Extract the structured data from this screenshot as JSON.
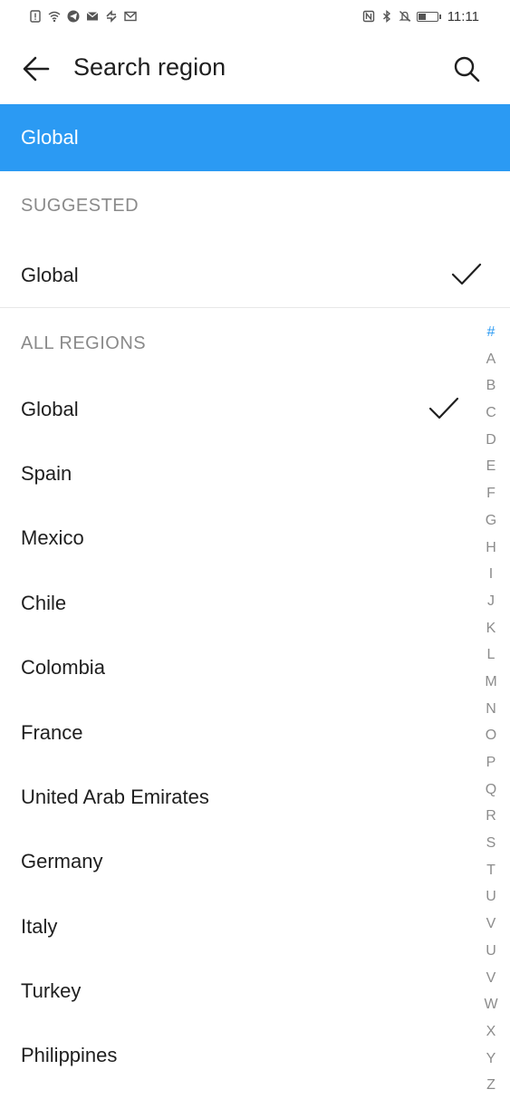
{
  "status_bar": {
    "left_icons": [
      "alert-icon",
      "wifi-icon",
      "telegram-icon",
      "mail-icon",
      "sync-icon",
      "gmail-icon"
    ],
    "right_icons": [
      "nfc-icon",
      "bluetooth-icon",
      "mute-icon",
      "battery-icon"
    ],
    "battery_level": 0.45,
    "time": "11:11"
  },
  "header": {
    "title": "Search region"
  },
  "selected": {
    "label": "Global"
  },
  "suggested": {
    "header": "SUGGESTED",
    "items": [
      {
        "label": "Global",
        "checked": true
      }
    ]
  },
  "all_regions": {
    "header": "ALL REGIONS",
    "items": [
      {
        "label": "Global",
        "checked": true
      },
      {
        "label": "Spain"
      },
      {
        "label": "Mexico"
      },
      {
        "label": "Chile"
      },
      {
        "label": "Colombia"
      },
      {
        "label": "France"
      },
      {
        "label": "United Arab Emirates"
      },
      {
        "label": "Germany"
      },
      {
        "label": "Italy"
      },
      {
        "label": "Turkey"
      },
      {
        "label": "Philippines"
      }
    ]
  },
  "index_bar": {
    "letters": [
      "#",
      "A",
      "B",
      "C",
      "D",
      "E",
      "F",
      "G",
      "H",
      "I",
      "J",
      "K",
      "L",
      "M",
      "N",
      "O",
      "P",
      "Q",
      "R",
      "S",
      "T",
      "U",
      "V",
      "U",
      "V",
      "W",
      "X",
      "Y",
      "Z"
    ],
    "active": "#"
  },
  "colors": {
    "accent": "#2b9af3",
    "text": "#1f1f1f",
    "muted": "#8a8a8a"
  }
}
